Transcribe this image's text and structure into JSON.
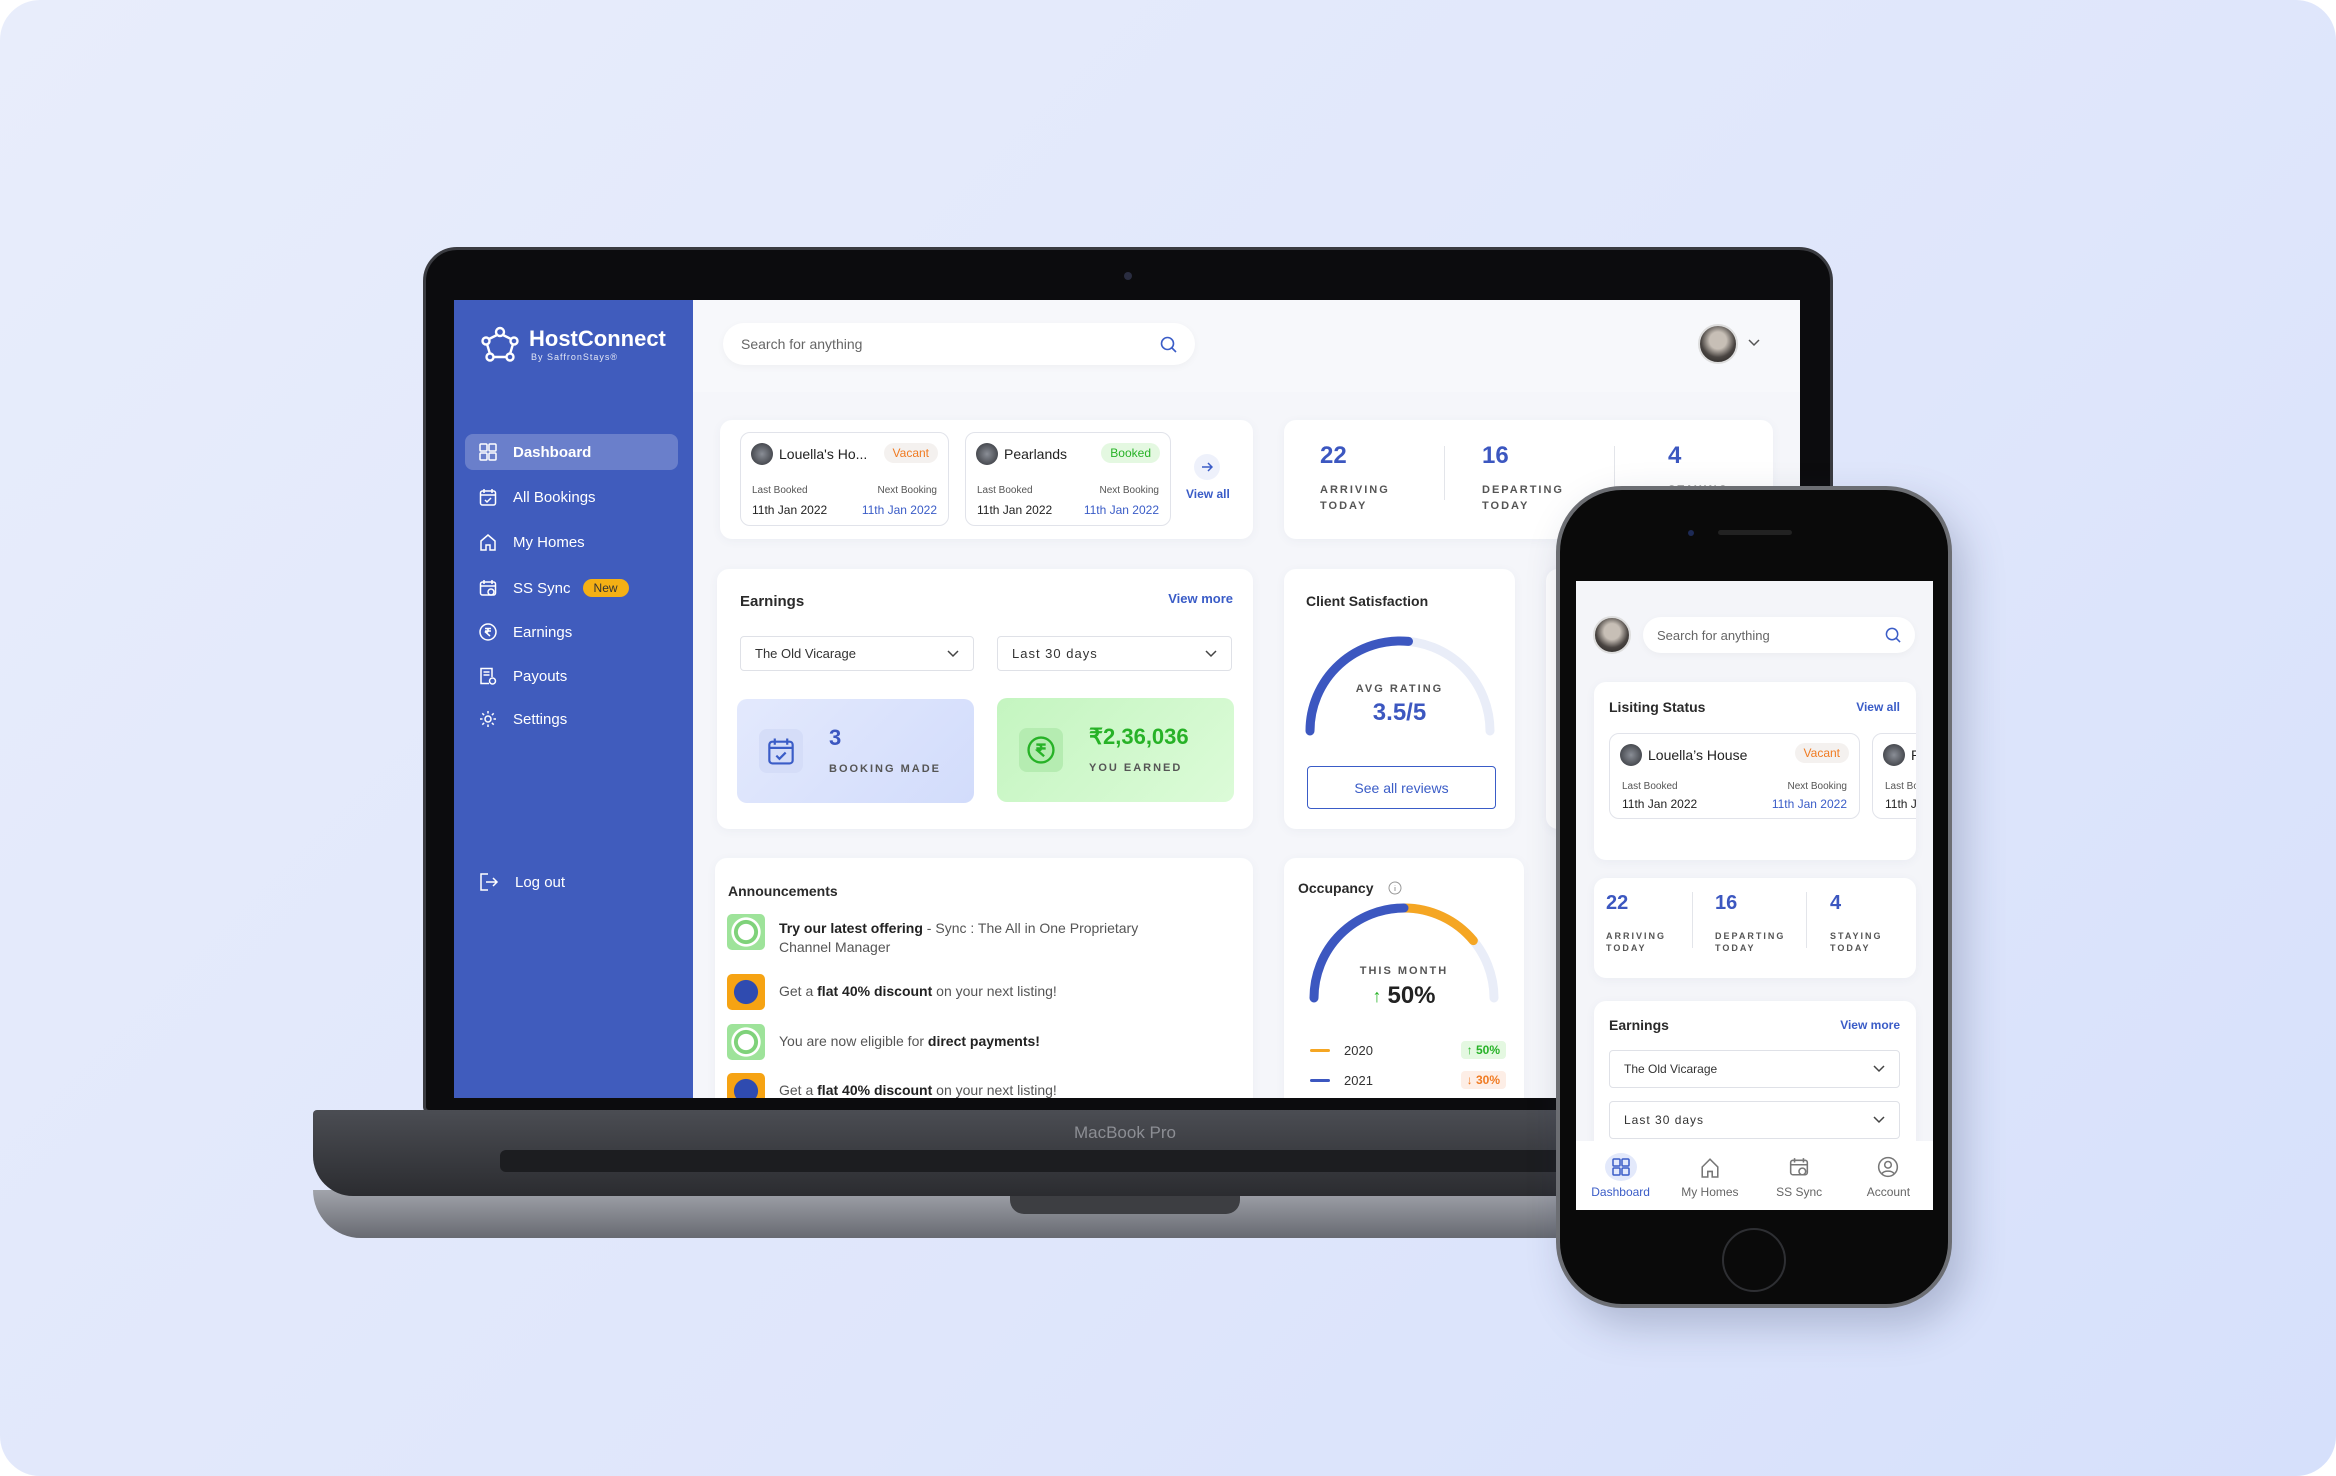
{
  "colors": {
    "primary": "#405cbd",
    "accent_blue": "#3a5cc7",
    "orange": "#f5a623",
    "green": "#27b227",
    "vacant": "#f07b22"
  },
  "laptop": {
    "brand_label": "MacBook Pro"
  },
  "brand": {
    "name": "HostConnect",
    "tagline": "By SaffronStays®"
  },
  "sidebar": {
    "items": [
      {
        "label": "Dashboard",
        "icon": "grid-icon",
        "active": true
      },
      {
        "label": "All Bookings",
        "icon": "calendar-check-icon"
      },
      {
        "label": "My Homes",
        "icon": "home-icon"
      },
      {
        "label": "SS Sync",
        "icon": "calendar-sync-icon",
        "badge": "New"
      },
      {
        "label": "Earnings",
        "icon": "rupee-circle-icon"
      },
      {
        "label": "Payouts",
        "icon": "receipt-icon"
      },
      {
        "label": "Settings",
        "icon": "gear-icon"
      }
    ],
    "logout": "Log out"
  },
  "search": {
    "placeholder": "Search for anything"
  },
  "listings": {
    "view_all": "View all",
    "title_mobile": "Lisiting Status",
    "cards": [
      {
        "name": "Louella's Ho...",
        "name_full": "Louella’s House",
        "status": "Vacant",
        "last_booked_label": "Last Booked",
        "last_booked": "11th Jan 2022",
        "next_booking_label": "Next Booking",
        "next_booking": "11th Jan 2022"
      },
      {
        "name": "Pearlands",
        "status": "Booked",
        "last_booked_label": "Last Booked",
        "last_booked": "11th Jan 2022",
        "next_booking_label": "Next Booking",
        "next_booking": "11th Jan 2022"
      }
    ]
  },
  "stats": [
    {
      "value": "22",
      "label": "ARRIVING TODAY"
    },
    {
      "value": "16",
      "label": "DEPARTING TODAY"
    },
    {
      "value": "4",
      "label": "STAYING TODAY"
    }
  ],
  "earnings": {
    "title": "Earnings",
    "view_more": "View more",
    "property": "The Old Vicarage",
    "period": "Last 30 days",
    "bookings_value": "3",
    "bookings_label": "BOOKING MADE",
    "earned_value": "₹2,36,036",
    "earned_label": "YOU EARNED"
  },
  "satisfaction": {
    "title": "Client Satisfaction",
    "gauge_label": "AVG RATING",
    "rating": "3.5/5",
    "button": "See all reviews"
  },
  "announcements": {
    "title": "Announcements",
    "items": [
      {
        "icon": "thumbs-up-badge-icon",
        "pre": "",
        "bold": "Try our latest offering",
        "post": " - Sync : The All in One Proprietary Channel Manager"
      },
      {
        "icon": "best-deal-icon",
        "pre": "Get a ",
        "bold": "flat 40% discount",
        "post": " on your next listing!"
      },
      {
        "icon": "thumbs-up-badge-icon",
        "pre": "You are now eligible for ",
        "bold": "direct payments!",
        "post": ""
      },
      {
        "icon": "best-deal-icon",
        "pre": "Get a ",
        "bold": "flat 40% discount",
        "post": " on your next listing!"
      }
    ]
  },
  "occupancy": {
    "title": "Occupancy",
    "gauge_label": "THIS MONTH",
    "value": "50%",
    "trend": "up",
    "legend": [
      {
        "year": "2020",
        "color": "#f5a623",
        "change": "↑ 50%",
        "trend": "up"
      },
      {
        "year": "2021",
        "color": "#3a5cc7",
        "change": "↓ 30%",
        "trend": "down"
      }
    ]
  },
  "mobile_nav": [
    {
      "label": "Dashboard",
      "icon": "grid-icon",
      "active": true
    },
    {
      "label": "My Homes",
      "icon": "home-icon"
    },
    {
      "label": "SS Sync",
      "icon": "calendar-sync-icon"
    },
    {
      "label": "Account",
      "icon": "user-circle-icon"
    }
  ]
}
